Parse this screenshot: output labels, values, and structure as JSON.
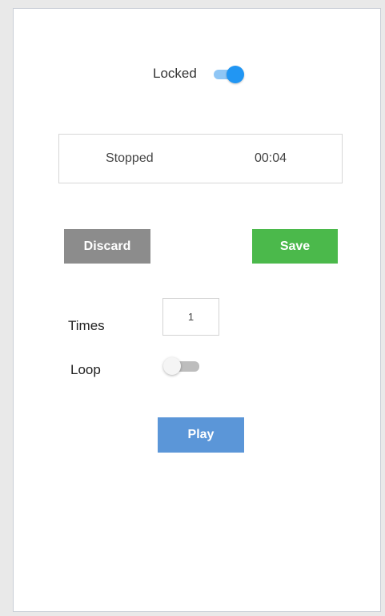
{
  "lock": {
    "label": "Locked",
    "on": true
  },
  "status": {
    "state": "Stopped",
    "time": "00:04"
  },
  "actions": {
    "discard_label": "Discard",
    "save_label": "Save",
    "play_label": "Play"
  },
  "times": {
    "label": "Times",
    "value": "1"
  },
  "loop": {
    "label": "Loop",
    "on": false
  },
  "colors": {
    "toggle_on_knob": "#2196f3",
    "toggle_on_track": "#8fc6f5",
    "discard": "#8c8c8c",
    "save": "#4bb94b",
    "play": "#5b96d8"
  }
}
